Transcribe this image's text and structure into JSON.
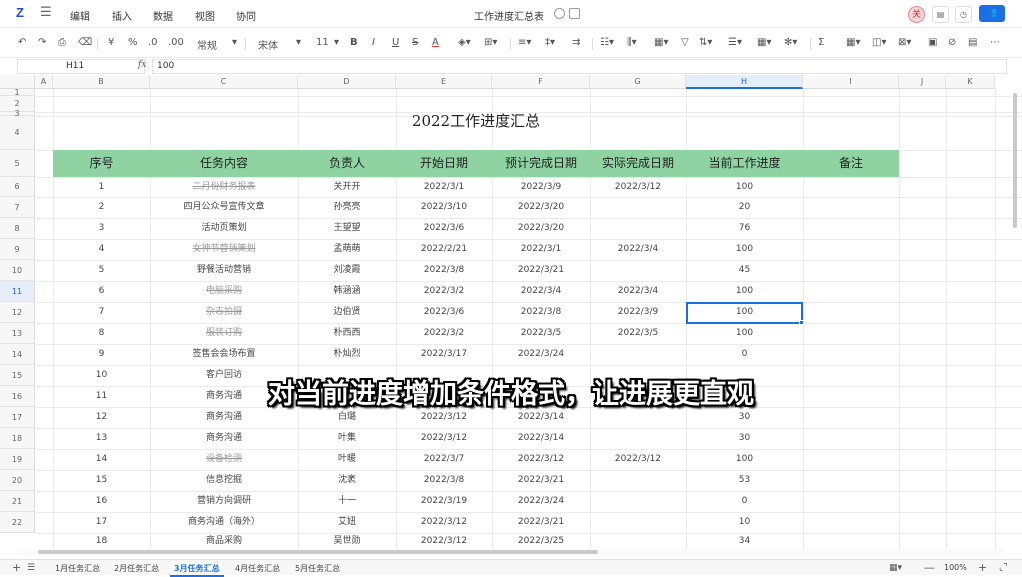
{
  "titlebar": {
    "logo": "Z",
    "menus": [
      "编辑",
      "插入",
      "数据",
      "视图",
      "协同"
    ],
    "doc_title": "工作进度汇总表",
    "avatar": "关"
  },
  "toolbar": {
    "number_format": "常规",
    "font": "宋体",
    "font_size": "11",
    "items": [
      "¥",
      "%",
      "B",
      "I",
      "U",
      "S",
      "A",
      "Σ"
    ]
  },
  "formula_bar": {
    "cell_ref": "H11",
    "fx": "fx",
    "value": "100"
  },
  "columns": [
    "A",
    "B",
    "C",
    "D",
    "E",
    "F",
    "G",
    "H",
    "I",
    "J",
    "K"
  ],
  "rows": [
    "1",
    "2",
    "3",
    "4",
    "5",
    "6",
    "7",
    "8",
    "9",
    "10",
    "11",
    "12",
    "13",
    "14",
    "15",
    "16",
    "17",
    "18",
    "19",
    "20",
    "21",
    "22"
  ],
  "sheet_title": "2022工作进度汇总",
  "headers": [
    "序号",
    "任务内容",
    "负责人",
    "开始日期",
    "预计完成日期",
    "实际完成日期",
    "当前工作进度",
    "备注"
  ],
  "table": [
    {
      "no": "1",
      "task": "二月份财务报表",
      "owner": "关开开",
      "start": "2022/3/1",
      "plan": "2022/3/9",
      "actual": "2022/3/12",
      "progress": "100",
      "done": true
    },
    {
      "no": "2",
      "task": "四月公众号宣传文章",
      "owner": "孙亮亮",
      "start": "2022/3/10",
      "plan": "2022/3/20",
      "actual": "",
      "progress": "20",
      "done": false
    },
    {
      "no": "3",
      "task": "活动页策划",
      "owner": "王望望",
      "start": "2022/3/6",
      "plan": "2022/3/20",
      "actual": "",
      "progress": "76",
      "done": false
    },
    {
      "no": "4",
      "task": "女神节营销策划",
      "owner": "孟萌萌",
      "start": "2022/2/21",
      "plan": "2022/3/1",
      "actual": "2022/3/4",
      "progress": "100",
      "done": true
    },
    {
      "no": "5",
      "task": "野餐活动营销",
      "owner": "刘凌霞",
      "start": "2022/3/8",
      "plan": "2022/3/21",
      "actual": "",
      "progress": "45",
      "done": false
    },
    {
      "no": "6",
      "task": "电脑采购",
      "owner": "韩涵涵",
      "start": "2022/3/2",
      "plan": "2022/3/4",
      "actual": "2022/3/4",
      "progress": "100",
      "done": true
    },
    {
      "no": "7",
      "task": "杂志拍摄",
      "owner": "边伯贤",
      "start": "2022/3/6",
      "plan": "2022/3/8",
      "actual": "2022/3/9",
      "progress": "100",
      "done": true
    },
    {
      "no": "8",
      "task": "服装订购",
      "owner": "朴西西",
      "start": "2022/3/2",
      "plan": "2022/3/5",
      "actual": "2022/3/5",
      "progress": "100",
      "done": true
    },
    {
      "no": "9",
      "task": "签售会会场布置",
      "owner": "朴灿烈",
      "start": "2022/3/17",
      "plan": "2022/3/24",
      "actual": "",
      "progress": "0",
      "done": false
    },
    {
      "no": "10",
      "task": "客户回访",
      "owner": "",
      "start": "",
      "plan": "",
      "actual": "",
      "progress": "",
      "done": false
    },
    {
      "no": "11",
      "task": "商务沟通",
      "owner": "",
      "start": "",
      "plan": "",
      "actual": "",
      "progress": "",
      "done": false
    },
    {
      "no": "12",
      "task": "商务沟通",
      "owner": "白璐",
      "start": "2022/3/12",
      "plan": "2022/3/14",
      "actual": "",
      "progress": "30",
      "done": false
    },
    {
      "no": "13",
      "task": "商务沟通",
      "owner": "叶集",
      "start": "2022/3/12",
      "plan": "2022/3/14",
      "actual": "",
      "progress": "30",
      "done": false
    },
    {
      "no": "14",
      "task": "设备检测",
      "owner": "叶暖",
      "start": "2022/3/7",
      "plan": "2022/3/12",
      "actual": "2022/3/12",
      "progress": "100",
      "done": true
    },
    {
      "no": "15",
      "task": "信息挖掘",
      "owner": "沈袤",
      "start": "2022/3/8",
      "plan": "2022/3/21",
      "actual": "",
      "progress": "53",
      "done": false
    },
    {
      "no": "16",
      "task": "营销方向调研",
      "owner": "十一",
      "start": "2022/3/19",
      "plan": "2022/3/24",
      "actual": "",
      "progress": "0",
      "done": false
    },
    {
      "no": "17",
      "task": "商务沟通（海外）",
      "owner": "艾妞",
      "start": "2022/3/12",
      "plan": "2022/3/21",
      "actual": "",
      "progress": "10",
      "done": false
    },
    {
      "no": "18",
      "task": "商品采购",
      "owner": "吴世勋",
      "start": "2022/3/12",
      "plan": "2022/3/25",
      "actual": "",
      "progress": "34",
      "done": false
    }
  ],
  "caption": "对当前进度增加条件格式，让进展更直观",
  "sheet_tabs": [
    "1月任务汇总",
    "2月任务汇总",
    "3月任务汇总",
    "4月任务汇总",
    "5月任务汇总"
  ],
  "active_tab": "3月任务汇总",
  "zoom": "100%",
  "colors": {
    "header_fill": "#8fd3a2",
    "accent": "#1a6ee6"
  }
}
